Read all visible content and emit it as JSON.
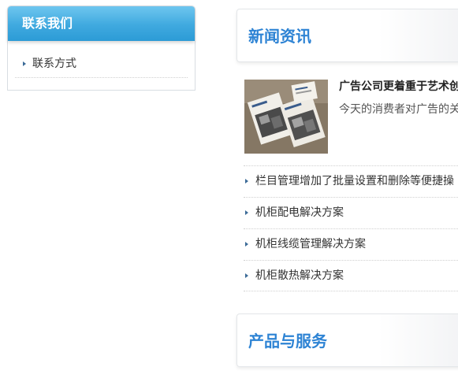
{
  "sidebar": {
    "title": "联系我们",
    "items": [
      {
        "label": "联系方式"
      }
    ]
  },
  "news": {
    "title": "新闻资讯",
    "featured": {
      "title": "广告公司更着重于艺术创",
      "summary": "今天的消费者对广告的关"
    },
    "items": [
      {
        "label": "栏目管理增加了批量设置和删除等便捷操"
      },
      {
        "label": "机柜配电解决方案"
      },
      {
        "label": "机柜线缆管理解决方案"
      },
      {
        "label": "机柜散热解决方案"
      }
    ]
  },
  "products": {
    "title": "产品与服务"
  },
  "colors": {
    "accent_blue": "#2d83d4",
    "sidebar_header": "#3fa9df"
  }
}
